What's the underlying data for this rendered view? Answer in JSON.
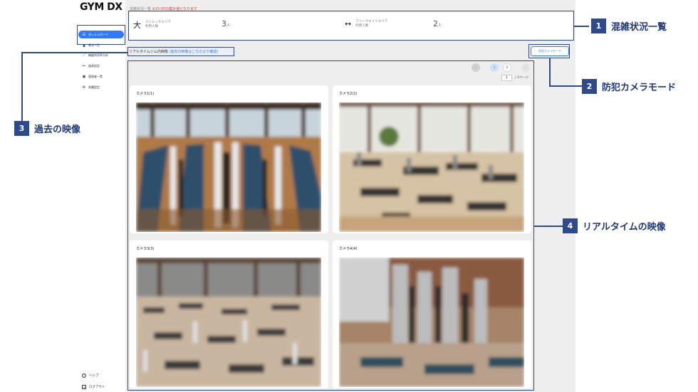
{
  "app": {
    "logo": "GYM DX",
    "notice_prefix": "混雑状況一覧",
    "notice_highlight": "※15:07の集計値となります"
  },
  "sidebar": {
    "items": [
      {
        "label": "ダッシュボード",
        "icon": "list-icon"
      },
      {
        "label": "異常一覧",
        "icon": "warning-icon"
      },
      {
        "label": "機器利用率分析",
        "icon": "chart-icon"
      },
      {
        "label": "器具設定",
        "icon": "dumbbell-icon"
      },
      {
        "label": "管理者一覧",
        "icon": "id-card-icon"
      },
      {
        "label": "各種設定",
        "icon": "gear-icon"
      }
    ],
    "bottom": [
      {
        "label": "ヘルプ",
        "icon": "help-icon"
      },
      {
        "label": "ログアウト",
        "icon": "logout-icon"
      }
    ]
  },
  "congestion": {
    "areas": [
      {
        "name": "ストレッチエリア",
        "sub": "利用人数",
        "count": "3",
        "unit": "人"
      },
      {
        "name": "フリーウエイトエリア",
        "sub": "利用人数",
        "count": "2",
        "unit": "人"
      }
    ]
  },
  "realtime": {
    "title": "リアルタイムジム内映像",
    "past_link": "(過去の映像はこちらより確認)",
    "security_button": "防犯カメラモード"
  },
  "pagination": {
    "prev": "‹",
    "pages": [
      "1",
      "2"
    ],
    "next": "›",
    "current": "1",
    "total": "/ 2ページ"
  },
  "cameras": [
    {
      "title": "カメラ1(1)"
    },
    {
      "title": "カメラ2(2)"
    },
    {
      "title": "カメラ3(3)"
    },
    {
      "title": "カメラ4(4)"
    }
  ],
  "annotations": [
    {
      "num": "1",
      "text": "混雑状況一覧"
    },
    {
      "num": "2",
      "text": "防犯カメラモード"
    },
    {
      "num": "3",
      "text": "過去の映像"
    },
    {
      "num": "4",
      "text": "リアルタイムの映像"
    }
  ],
  "colors": {
    "accent": "#2e7bff",
    "annotation": "#2f4a8c",
    "notice_red": "#e03a3a"
  }
}
